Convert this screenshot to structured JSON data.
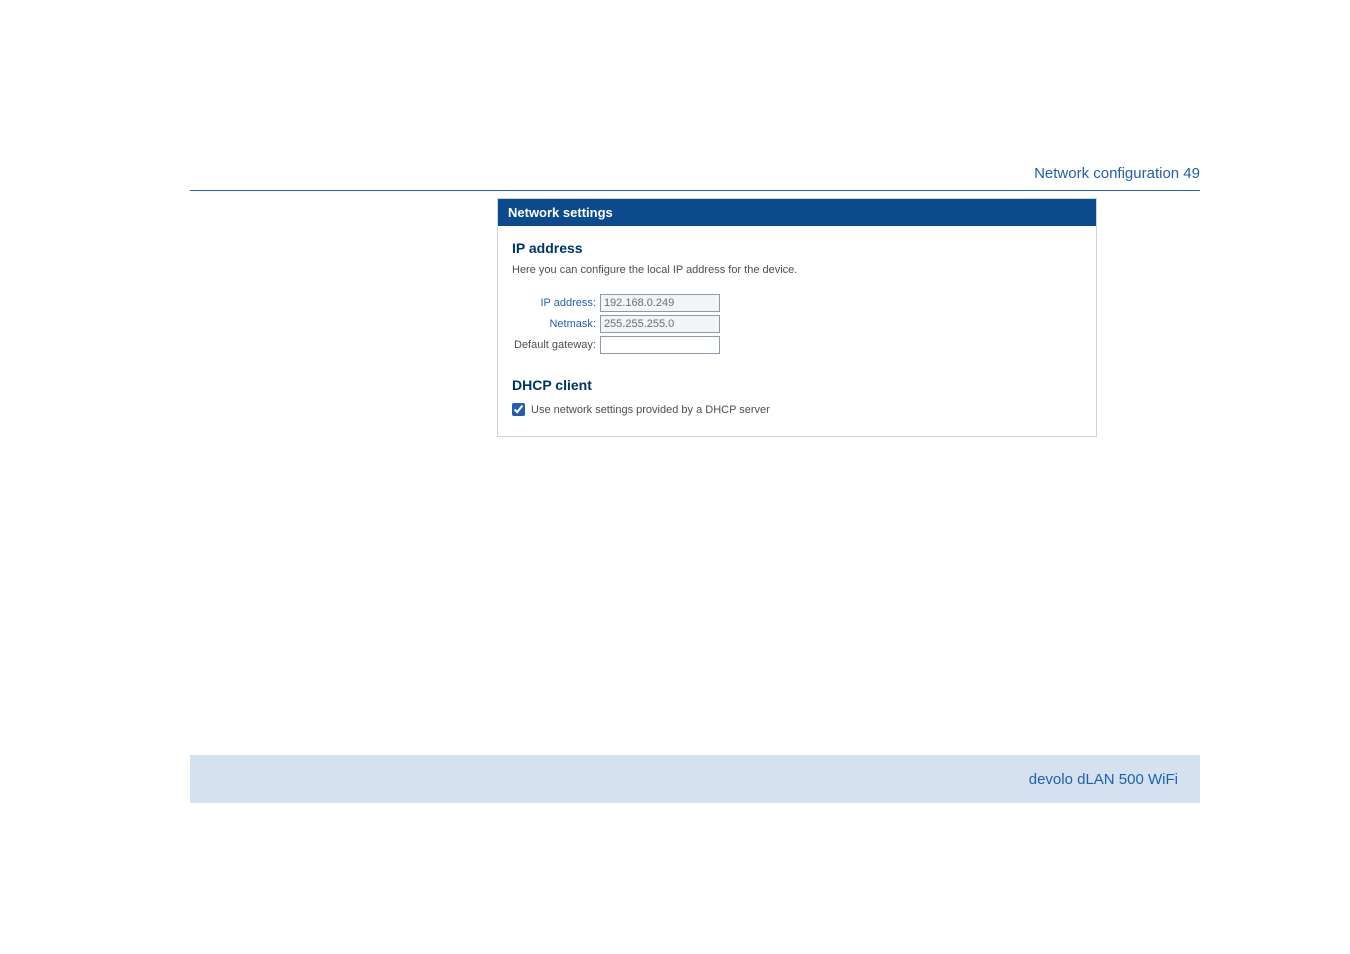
{
  "header": {
    "breadcrumb": "Network configuration 49"
  },
  "panel": {
    "title": "Network settings",
    "ip_section": {
      "heading": "IP address",
      "description": "Here you can configure the local IP address for the device.",
      "fields": {
        "ip_label": "IP address:",
        "ip_value": "192.168.0.249",
        "netmask_label": "Netmask:",
        "netmask_value": "255.255.255.0",
        "gateway_label": "Default gateway:",
        "gateway_value": ""
      }
    },
    "dhcp_section": {
      "heading": "DHCP client",
      "checkbox_label": "Use network settings provided by a DHCP server",
      "checkbox_checked": true
    }
  },
  "footer": {
    "product": "devolo dLAN 500 WiFi"
  }
}
